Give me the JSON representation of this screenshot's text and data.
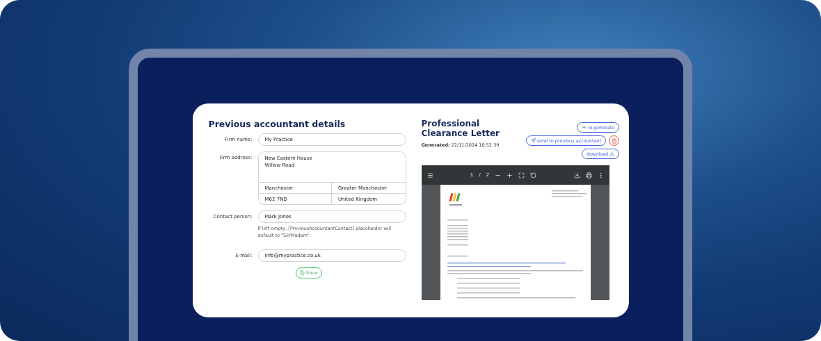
{
  "details": {
    "title": "Previous accountant details",
    "fields": [
      {
        "kind": "text",
        "label": "Firm name:",
        "value": "My Practice"
      },
      {
        "kind": "address",
        "label": "Firm address:",
        "value": "New Eastern House\nWillow Road",
        "cells": [
          "Manchester",
          "Greater Manchester",
          "M62 7ND",
          "United Kingdom"
        ]
      },
      {
        "kind": "text",
        "label": "Contact person:",
        "value": "Mark Jones",
        "hint": "If left empty, [PreviousAccountantContact] placeholder will default to \"Sir/Madam\"."
      },
      {
        "kind": "text",
        "label": "E-mail:",
        "value": "info@mypractice.co.uk"
      }
    ],
    "save": "Save"
  },
  "letter": {
    "title": "Professional Clearance Letter",
    "generated_label": "Generated:",
    "generated": "22/11/2024 10:52:39",
    "buttons": [
      {
        "kind": "regenerate",
        "label": "re-generate"
      },
      {
        "kind": "send",
        "label": "send to previous accountant"
      },
      {
        "kind": "delete"
      },
      {
        "kind": "download",
        "label": "download"
      }
    ],
    "viewer": {
      "page": "1",
      "separator": "/",
      "pages": "2"
    }
  }
}
